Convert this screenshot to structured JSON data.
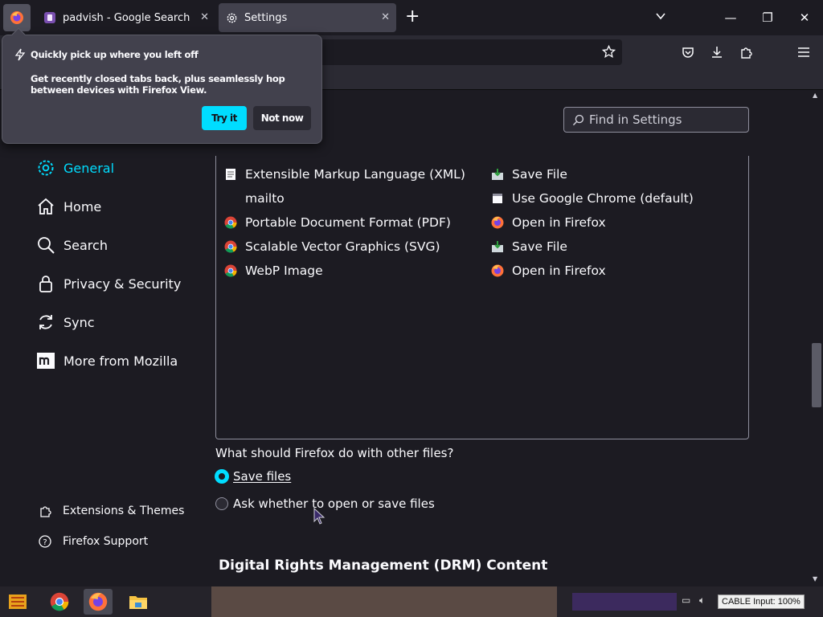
{
  "tabs": [
    {
      "title": "padvish - Google Search",
      "close": "✕"
    },
    {
      "title": "Settings",
      "close": "✕"
    }
  ],
  "newtab_label": "+",
  "window_controls": {
    "minimize": "—",
    "maximize": "❐",
    "close": "✕"
  },
  "search": {
    "placeholder": "Find in Settings"
  },
  "sidebar": {
    "items": [
      {
        "label": "General"
      },
      {
        "label": "Home"
      },
      {
        "label": "Search"
      },
      {
        "label": "Privacy & Security"
      },
      {
        "label": "Sync"
      },
      {
        "label": "More from Mozilla"
      }
    ],
    "footer": [
      {
        "label": "Extensions & Themes"
      },
      {
        "label": "Firefox Support"
      }
    ]
  },
  "applications": {
    "rows": [
      {
        "content_type": "Extensible Markup Language (XML)",
        "action": "Save File"
      },
      {
        "content_type": "mailto",
        "action": "Use Google Chrome (default)"
      },
      {
        "content_type": "Portable Document Format (PDF)",
        "action": "Open in Firefox"
      },
      {
        "content_type": "Scalable Vector Graphics (SVG)",
        "action": "Save File"
      },
      {
        "content_type": "WebP Image",
        "action": "Open in Firefox"
      }
    ]
  },
  "other_files": {
    "question": "What should Firefox do with other files?",
    "options": [
      {
        "label": "Save files",
        "selected": true
      },
      {
        "label": "Ask whether to open or save files",
        "selected": false
      }
    ]
  },
  "drm_heading": "Digital Rights Management (DRM) Content",
  "popup": {
    "title": "Quickly pick up where you left off",
    "body": "Get recently closed tabs back, plus seamlessly hop between devices with Firefox View.",
    "try_label": "Try it",
    "not_now_label": "Not now"
  },
  "taskbar": {
    "tray_text": "CABLE Input: 100%"
  },
  "colors": {
    "accent": "#00ddff",
    "background": "#1c1b22",
    "toolbar": "#2b2a33"
  }
}
